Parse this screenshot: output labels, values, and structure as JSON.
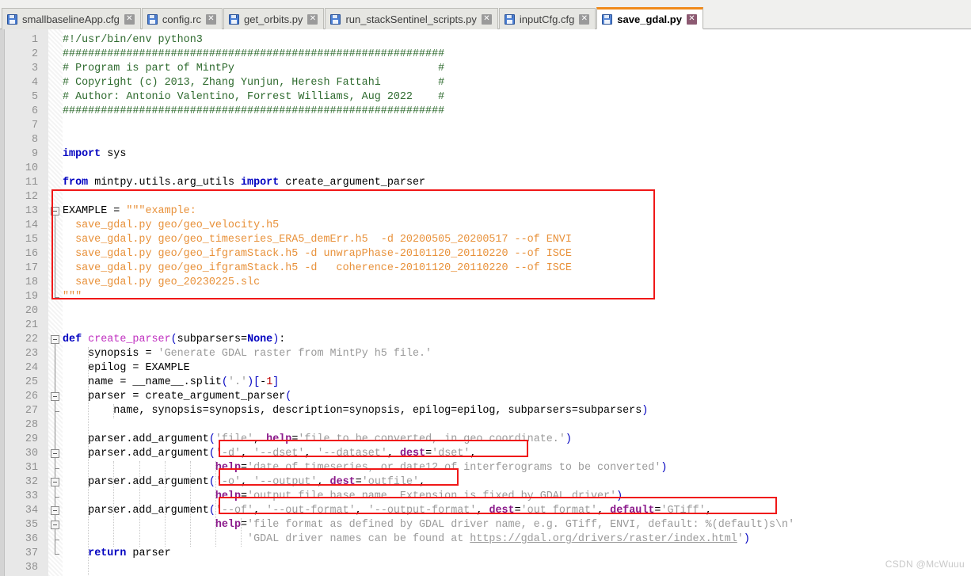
{
  "window": {
    "title": "save_gdal.py",
    "watermark": "CSDN @McWuuu"
  },
  "tabs": [
    {
      "label": "smallbaselineApp.cfg",
      "icon": "save-file-icon",
      "close": "✕",
      "active": false
    },
    {
      "label": "config.rc",
      "icon": "save-file-icon",
      "close": "✕",
      "active": false
    },
    {
      "label": "get_orbits.py",
      "icon": "save-file-icon",
      "close": "✕",
      "active": false
    },
    {
      "label": "run_stackSentinel_scripts.py",
      "icon": "save-file-icon",
      "close": "✕",
      "active": false
    },
    {
      "label": "inputCfg.cfg",
      "icon": "save-file-icon",
      "close": "✕",
      "active": false
    },
    {
      "label": "save_gdal.py",
      "icon": "save-file-icon",
      "close": "✕",
      "active": true
    }
  ],
  "editor": {
    "first_line": 1,
    "last_line": 38,
    "language": "python",
    "line_numbers": [
      1,
      2,
      3,
      4,
      5,
      6,
      7,
      8,
      9,
      10,
      11,
      12,
      13,
      14,
      15,
      16,
      17,
      18,
      19,
      20,
      21,
      22,
      23,
      24,
      25,
      26,
      27,
      28,
      29,
      30,
      31,
      32,
      33,
      34,
      35,
      36,
      37,
      38
    ],
    "lines": [
      {
        "n": 1,
        "text": "#!/usr/bin/env python3"
      },
      {
        "n": 2,
        "text": "############################################################"
      },
      {
        "n": 3,
        "text": "# Program is part of MintPy                                #"
      },
      {
        "n": 4,
        "text": "# Copyright (c) 2013, Zhang Yunjun, Heresh Fattahi         #"
      },
      {
        "n": 5,
        "text": "# Author: Antonio Valentino, Forrest Williams, Aug 2022    #"
      },
      {
        "n": 6,
        "text": "############################################################"
      },
      {
        "n": 7,
        "text": ""
      },
      {
        "n": 8,
        "text": ""
      },
      {
        "n": 9,
        "text": "import sys"
      },
      {
        "n": 10,
        "text": ""
      },
      {
        "n": 11,
        "text": "from mintpy.utils.arg_utils import create_argument_parser"
      },
      {
        "n": 12,
        "text": ""
      },
      {
        "n": 13,
        "text": "EXAMPLE = \"\"\"example:"
      },
      {
        "n": 14,
        "text": "  save_gdal.py geo/geo_velocity.h5"
      },
      {
        "n": 15,
        "text": "  save_gdal.py geo/geo_timeseries_ERA5_demErr.h5  -d 20200505_20200517 --of ENVI"
      },
      {
        "n": 16,
        "text": "  save_gdal.py geo/geo_ifgramStack.h5 -d unwrapPhase-20101120_20110220 --of ISCE"
      },
      {
        "n": 17,
        "text": "  save_gdal.py geo/geo_ifgramStack.h5 -d   coherence-20101120_20110220 --of ISCE"
      },
      {
        "n": 18,
        "text": "  save_gdal.py geo_20230225.slc"
      },
      {
        "n": 19,
        "text": "\"\"\""
      },
      {
        "n": 20,
        "text": ""
      },
      {
        "n": 21,
        "text": ""
      },
      {
        "n": 22,
        "text": "def create_parser(subparsers=None):"
      },
      {
        "n": 23,
        "text": "    synopsis = 'Generate GDAL raster from MintPy h5 file.'"
      },
      {
        "n": 24,
        "text": "    epilog = EXAMPLE"
      },
      {
        "n": 25,
        "text": "    name = __name__.split('.')[-1]"
      },
      {
        "n": 26,
        "text": "    parser = create_argument_parser("
      },
      {
        "n": 27,
        "text": "        name, synopsis=synopsis, description=synopsis, epilog=epilog, subparsers=subparsers)"
      },
      {
        "n": 28,
        "text": ""
      },
      {
        "n": 29,
        "text": "    parser.add_argument('file', help='file to be converted, in geo coordinate.')"
      },
      {
        "n": 30,
        "text": "    parser.add_argument('-d', '--dset', '--dataset', dest='dset',"
      },
      {
        "n": 31,
        "text": "                        help='date of timeseries, or date12 of interferograms to be converted')"
      },
      {
        "n": 32,
        "text": "    parser.add_argument('-o', '--output', dest='outfile',"
      },
      {
        "n": 33,
        "text": "                        help='output file base name. Extension is fixed by GDAL driver')"
      },
      {
        "n": 34,
        "text": "    parser.add_argument('--of', '--out-format', '--output-format', dest='out_format', default='GTiff',"
      },
      {
        "n": 35,
        "text": "                        help='file format as defined by GDAL driver name, e.g. GTiff, ENVI, default: %(default)s\\n'"
      },
      {
        "n": 36,
        "text": "                             'GDAL driver names can be found at https://gdal.org/drivers/raster/index.html')"
      },
      {
        "n": 37,
        "text": "    return parser"
      },
      {
        "n": 38,
        "text": ""
      }
    ],
    "fold_markers": [
      13,
      22,
      26,
      30,
      32,
      34,
      35
    ],
    "annotations": [
      {
        "name": "example-block-highlight",
        "target_lines": "13-19"
      },
      {
        "name": "dset-argument-highlight",
        "target_lines": "30"
      },
      {
        "name": "output-argument-highlight",
        "target_lines": "32"
      },
      {
        "name": "out-format-argument-highlight",
        "target_lines": "34"
      }
    ]
  },
  "colors": {
    "accent": "#f08a1a",
    "annotation": "#f01818",
    "keyword": "#0000c0",
    "comment": "#2f6b2f",
    "string": "#9a9a9a",
    "docstring": "#e8913a",
    "kwarg": "#8b1a8b",
    "function": "#c030c0",
    "number": "#c00000",
    "gutter_bg": "#e8e8e8",
    "linenumber": "#919191"
  }
}
